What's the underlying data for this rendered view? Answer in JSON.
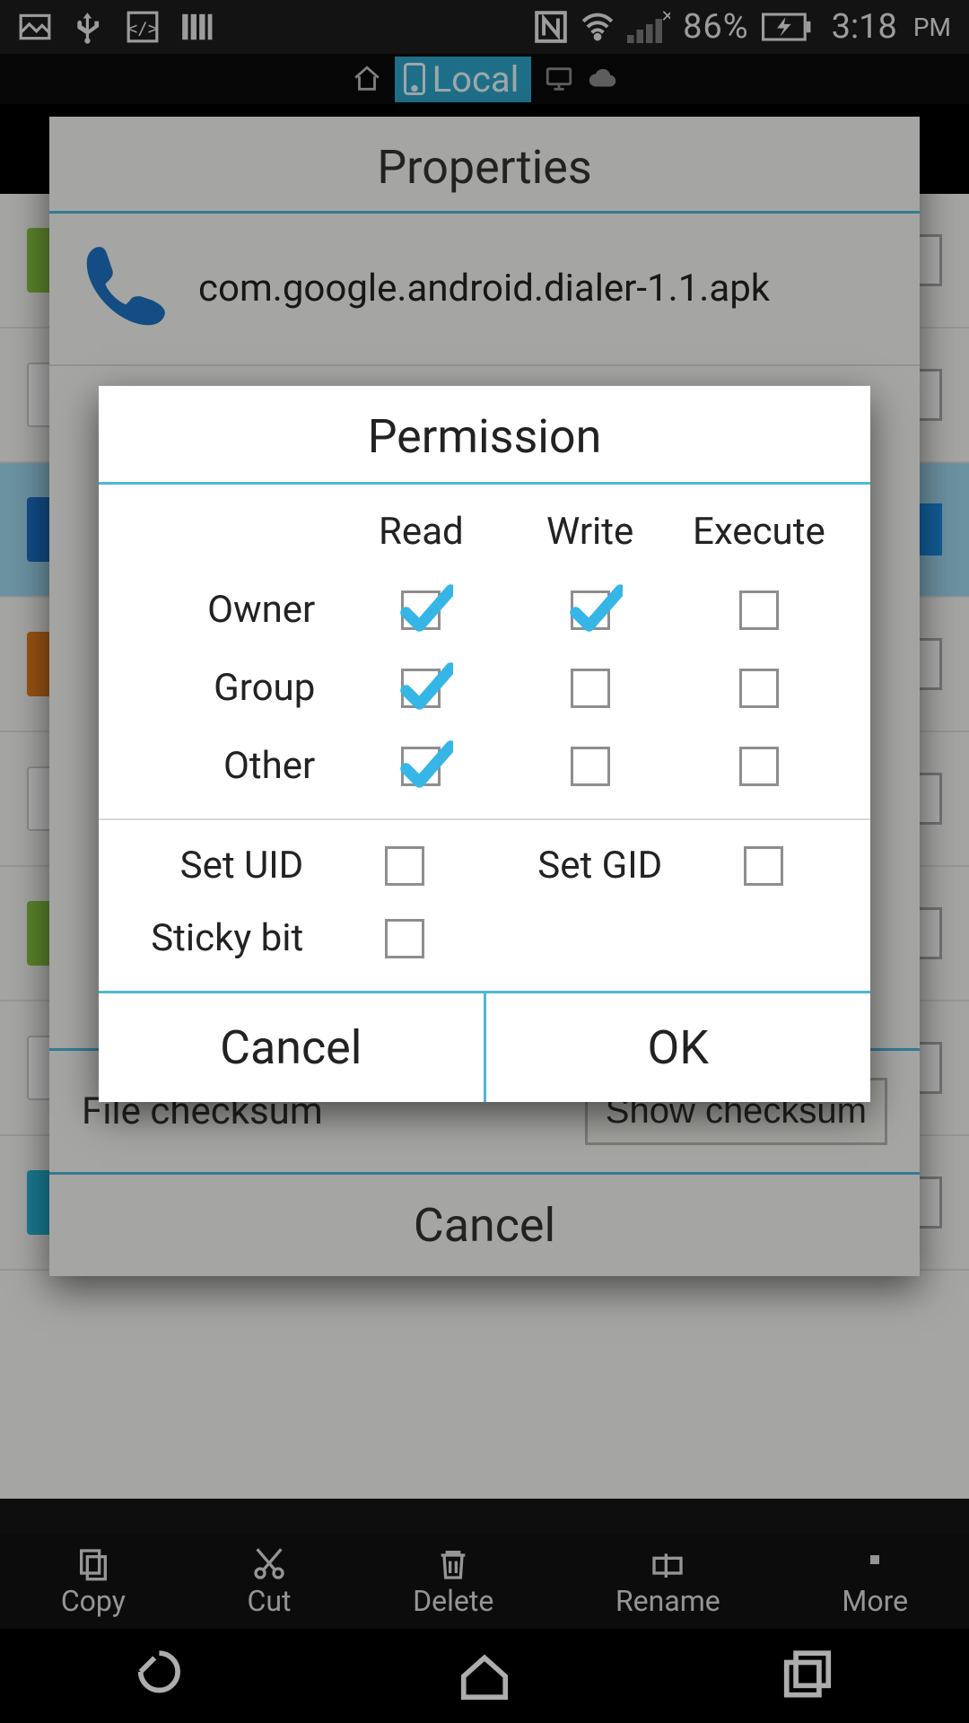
{
  "status": {
    "battery_pct": "86%",
    "clock": "3:18",
    "ampm": "PM"
  },
  "loc": {
    "local_label": "Local"
  },
  "properties": {
    "title": "Properties",
    "file_name": "com.google.android.dialer-1.1.apk",
    "checksum_label": "File checksum",
    "show_checksum_btn": "Show checksum",
    "cancel": "Cancel"
  },
  "perm": {
    "title": "Permission",
    "headers": {
      "read": "Read",
      "write": "Write",
      "execute": "Execute"
    },
    "rows": {
      "owner": "Owner",
      "group": "Group",
      "other": "Other"
    },
    "matrix": {
      "owner": {
        "read": true,
        "write": true,
        "execute": false
      },
      "group": {
        "read": true,
        "write": false,
        "execute": false
      },
      "other": {
        "read": true,
        "write": false,
        "execute": false
      }
    },
    "extra": {
      "set_uid": "Set UID",
      "set_gid": "Set GID",
      "sticky": "Sticky bit",
      "uid": false,
      "gid": false,
      "sticky_val": false
    },
    "buttons": {
      "cancel": "Cancel",
      "ok": "OK"
    }
  },
  "actions": {
    "copy": "Copy",
    "cut": "Cut",
    "delete": "Delete",
    "rename": "Rename",
    "more": "More"
  }
}
